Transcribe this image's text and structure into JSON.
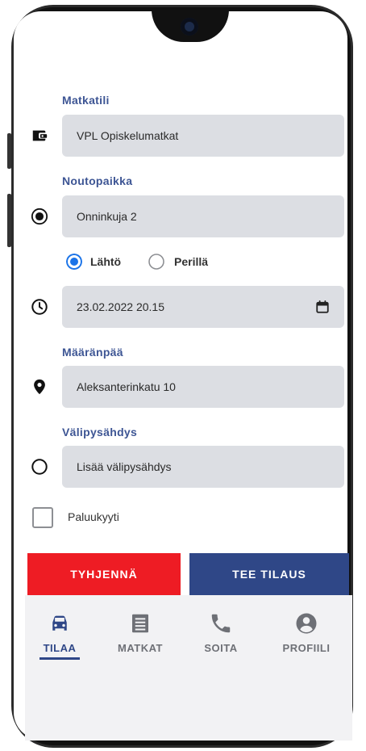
{
  "form": {
    "account": {
      "label": "Matkatili",
      "value": "VPL Opiskelumatkat",
      "icon": "wallet-icon"
    },
    "pickup": {
      "label": "Noutopaikka",
      "value": "Onninkuja 2",
      "icon": "radio-target-icon"
    },
    "time_mode": {
      "options": [
        {
          "label": "Lähtö",
          "selected": true
        },
        {
          "label": "Perillä",
          "selected": false
        }
      ]
    },
    "datetime": {
      "value": "23.02.2022 20.15",
      "icon": "clock-icon",
      "trailing_icon": "calendar-icon"
    },
    "destination": {
      "label": "Määränpää",
      "value": "Aleksanterinkatu 10",
      "icon": "map-pin-icon"
    },
    "stopover": {
      "label": "Välipysähdys",
      "placeholder": "Lisää välipysähdys",
      "icon": "circle-icon"
    },
    "return_trip": {
      "label": "Paluukyyti",
      "checked": false
    }
  },
  "actions": {
    "clear_label": "TYHJENNÄ",
    "order_label": "TEE TILAUS"
  },
  "bottom_nav": {
    "items": [
      {
        "label": "TILAA",
        "icon": "car-icon",
        "active": true
      },
      {
        "label": "MATKAT",
        "icon": "list-icon",
        "active": false
      },
      {
        "label": "SOITA",
        "icon": "phone-icon",
        "active": false
      },
      {
        "label": "PROFIILI",
        "icon": "account-icon",
        "active": false
      }
    ]
  },
  "colors": {
    "accent": "#3d5594",
    "primary_button": "#2f4787",
    "danger_button": "#ee1c24",
    "radio_selected": "#1a73e8",
    "field_bg": "#dcdee3"
  }
}
